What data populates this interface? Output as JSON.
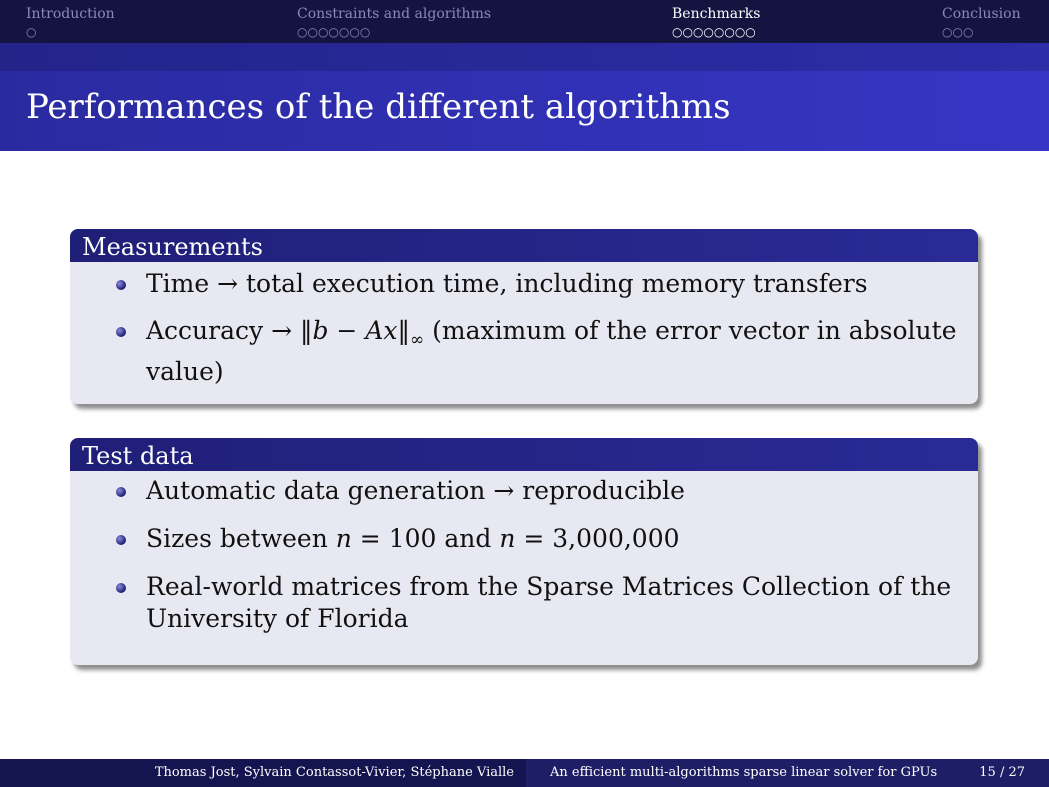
{
  "nav": {
    "sections": [
      {
        "label": "Introduction",
        "dots": "○"
      },
      {
        "label": "Constraints and algorithms",
        "dots": "○○○○○○○"
      },
      {
        "label": "Benchmarks",
        "dots": "○○○○○○○○"
      },
      {
        "label": "Conclusion",
        "dots": "○○○"
      }
    ]
  },
  "title": "Performances of the different algorithms",
  "blocks": [
    {
      "title": "Measurements",
      "items": [
        {
          "text": "Time → total execution time, including memory transfers"
        },
        {
          "pre": "Accuracy → ‖",
          "math": "b − Ax",
          "post": "‖",
          "sub": "∞",
          "tail": " (maximum of the error vector in absolute value)"
        }
      ]
    },
    {
      "title": "Test data",
      "items": [
        {
          "text": "Automatic data generation → reproducible"
        },
        {
          "p1": "Sizes between ",
          "m1": "n",
          "p2": " = 100 and ",
          "m2": "n",
          "p3": " = 3,000,000"
        },
        {
          "text": "Real-world matrices from the Sparse Matrices Collection of the University of Florida"
        }
      ]
    }
  ],
  "footer": {
    "authors": "Thomas Jost, Sylvain Contassot-Vivier, Stéphane Vialle",
    "talk_title": "An efficient multi-algorithms sparse linear solver for GPUs",
    "page": "15 / 27"
  },
  "colors": {
    "nav_bg": "#141440",
    "title_bg": "#3636c6",
    "block_title_bg": "#2a2a96",
    "block_body_bg": "#e8e8f2"
  }
}
